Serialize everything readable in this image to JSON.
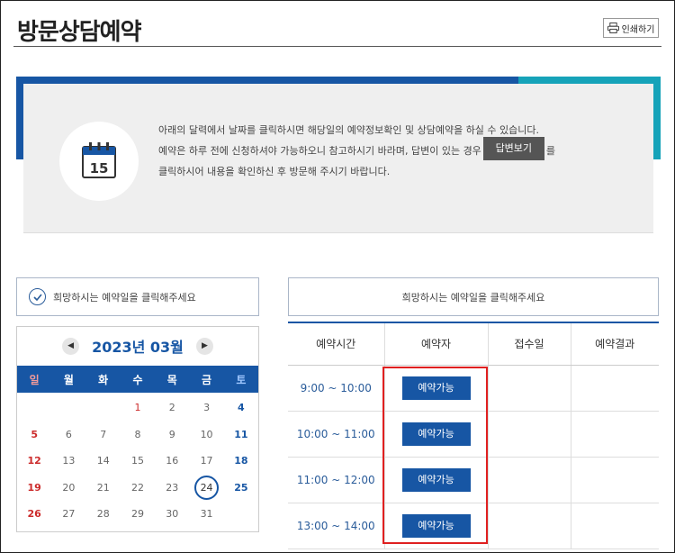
{
  "page": {
    "title": "방문상담예약",
    "print_label": "인쇄하기"
  },
  "info": {
    "calendar_day": "15",
    "line1": "아래의 달력에서 날짜를 클릭하시면 해당일의 예약정보확인 및 상담예약을 하실 수 있습니다.",
    "line2_before": "예약은 하루 전에 신청하셔야 가능하오니 참고하시기 바라며, 답변이 있는 경우",
    "answer_button": "답변보기",
    "line2_after": "를",
    "line3": "클릭하시어 내용을 확인하신 후 방문해 주시기 바랍니다."
  },
  "prompts": {
    "left": "희망하시는 예약일을 클릭해주세요",
    "right": "희망하시는 예약일을 클릭해주세요"
  },
  "calendar": {
    "month_label": "2023년 03월",
    "prev": "◀",
    "next": "▶",
    "weekdays": [
      "일",
      "월",
      "화",
      "수",
      "목",
      "금",
      "토"
    ],
    "weeks": [
      [
        "",
        "",
        "",
        "1",
        "2",
        "3",
        "4"
      ],
      [
        "5",
        "6",
        "7",
        "8",
        "9",
        "10",
        "11"
      ],
      [
        "12",
        "13",
        "14",
        "15",
        "16",
        "17",
        "18"
      ],
      [
        "19",
        "20",
        "21",
        "22",
        "23",
        "24",
        "25"
      ],
      [
        "26",
        "27",
        "28",
        "29",
        "30",
        "31",
        ""
      ]
    ],
    "selected_day": "24",
    "holiday_day": "1"
  },
  "reservation_table": {
    "headers": [
      "예약시간",
      "예약자",
      "접수일",
      "예약결과"
    ],
    "rows": [
      {
        "time": "9:00 ~ 10:00",
        "button": "예약가능"
      },
      {
        "time": "10:00 ~ 11:00",
        "button": "예약가능"
      },
      {
        "time": "11:00 ~ 12:00",
        "button": "예약가능"
      },
      {
        "time": "13:00 ~ 14:00",
        "button": "예약가능"
      }
    ]
  },
  "colors": {
    "primary": "#1756a4",
    "accent_teal": "#16a3b9",
    "highlight": "#e02020"
  }
}
